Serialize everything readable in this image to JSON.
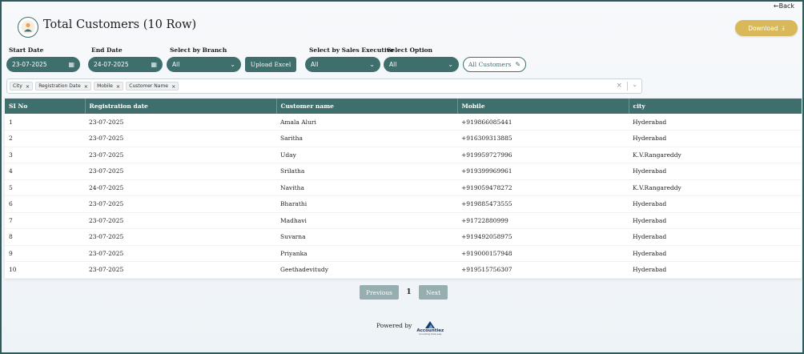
{
  "nav": {
    "back_label": "←Back"
  },
  "header": {
    "title": "Total Customers (10 Row)",
    "download_label": "Download"
  },
  "filters": {
    "start_date_label": "Start Date",
    "start_date_value": "23-07-2025",
    "end_date_label": "End Date",
    "end_date_value": "24-07-2025",
    "branch_label": "Select by Branch",
    "branch_value": "All",
    "upload_label": "Upload Excel",
    "sales_exec_label": "Select by Sales Executive",
    "sales_exec_value": "All",
    "option_label": "Select Option",
    "option_value": "All",
    "all_customers_label": "All Customers"
  },
  "column_tags": [
    "City",
    "Registration Date",
    "Mobile",
    "Customer Name"
  ],
  "table": {
    "headers": [
      "SI No",
      "Registration date",
      "Customer name",
      "Mobile",
      "city"
    ],
    "rows": [
      [
        "1",
        "23-07-2025",
        "Amala Aluri",
        "+919866085441",
        "Hyderabad"
      ],
      [
        "2",
        "23-07-2025",
        "Saritha",
        "+916309313885",
        "Hyderabad"
      ],
      [
        "3",
        "23-07-2025",
        "Uday",
        "+919959727996",
        "K.V.Rangareddy"
      ],
      [
        "4",
        "23-07-2025",
        "Srilatha",
        "+919399969961",
        "Hyderabad"
      ],
      [
        "5",
        "24-07-2025",
        "Navitha",
        "+919059478272",
        "K.V.Rangareddy"
      ],
      [
        "6",
        "23-07-2025",
        "Bharathi",
        "+919885473555",
        "Hyderabad"
      ],
      [
        "7",
        "23-07-2025",
        "Madhavi",
        "+91722880999",
        "Hyderabad"
      ],
      [
        "8",
        "23-07-2025",
        "Suvarna",
        "+919492058975",
        "Hyderabad"
      ],
      [
        "9",
        "23-07-2025",
        "Priyanka",
        "+919000157948",
        "Hyderabad"
      ],
      [
        "10",
        "23-07-2025",
        "Geethadevitudy",
        "+919515756307",
        "Hyderabad"
      ]
    ]
  },
  "pagination": {
    "prev_label": "Previous",
    "current_page": "1",
    "next_label": "Next"
  },
  "footer": {
    "powered_label": "Powered by",
    "brand_name": "Accountiez",
    "brand_tagline": "Accounting made easy"
  },
  "colors": {
    "primary": "#3e6f6d",
    "accent": "#d9b85a",
    "disabled": "#97aeb0"
  },
  "icons": {
    "logo": "person-avatar-icon",
    "download": "download-icon",
    "calendar": "calendar-icon",
    "dropdown": "chevron-down-icon",
    "edit": "pencil-icon",
    "tag_remove": "close-icon",
    "clear": "close-icon"
  }
}
